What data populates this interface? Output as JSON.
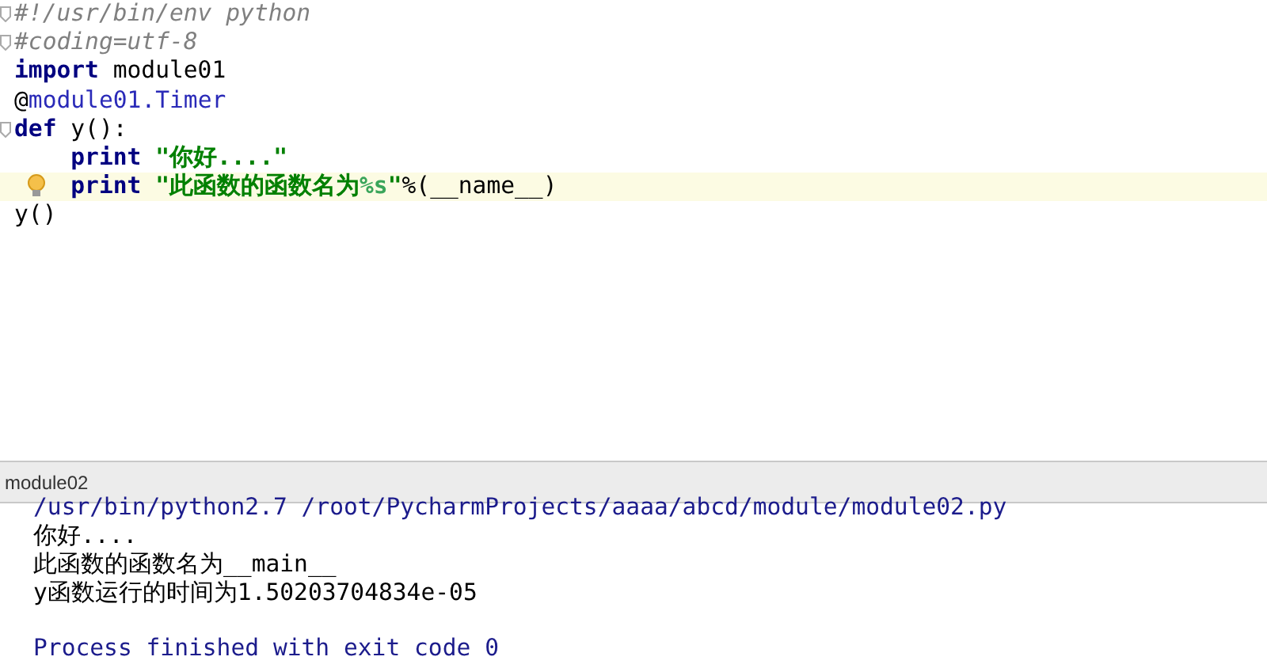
{
  "editor": {
    "lines": [
      {
        "current": false,
        "bulb": false,
        "foldable": true,
        "tokens": [
          {
            "kind": "comment",
            "text": "#!/usr/bin/env python"
          }
        ]
      },
      {
        "current": false,
        "bulb": false,
        "foldable": true,
        "tokens": [
          {
            "kind": "comment",
            "text": "#coding=utf-8"
          }
        ]
      },
      {
        "current": false,
        "bulb": false,
        "foldable": false,
        "tokens": [
          {
            "kind": "keyword",
            "text": "import "
          },
          {
            "kind": "plain",
            "text": "module01"
          }
        ]
      },
      {
        "current": false,
        "bulb": false,
        "foldable": false,
        "tokens": [
          {
            "kind": "plain",
            "text": "@"
          },
          {
            "kind": "decorator",
            "text": "module01.Timer"
          }
        ]
      },
      {
        "current": false,
        "bulb": false,
        "foldable": true,
        "tokens": [
          {
            "kind": "keyword",
            "text": "def "
          },
          {
            "kind": "plain",
            "text": "y():"
          }
        ],
        "children": [
          {
            "current": false,
            "bulb": false,
            "foldable": false,
            "tokens": [
              {
                "kind": "keyword",
                "text": "print "
              },
              {
                "kind": "string",
                "text": "\"你好....\""
              }
            ]
          },
          {
            "current": true,
            "bulb": true,
            "foldable": false,
            "tokens": [
              {
                "kind": "keyword",
                "text": "print "
              },
              {
                "kind": "string",
                "text": "\"此函数的函数名为"
              },
              {
                "kind": "format",
                "text": "%s"
              },
              {
                "kind": "string",
                "text": "\""
              },
              {
                "kind": "plain",
                "text": "%(__name__)"
              }
            ]
          }
        ]
      },
      {
        "current": false,
        "bulb": false,
        "foldable": false,
        "tokens": [
          {
            "kind": "plain",
            "text": "y()"
          }
        ]
      }
    ]
  },
  "run_panel": {
    "title": "module02",
    "output": [
      {
        "kind": "command",
        "text": "/usr/bin/python2.7 /root/PycharmProjects/aaaa/abcd/module/module02.py"
      },
      {
        "kind": "stdout",
        "text": "你好...."
      },
      {
        "kind": "stdout",
        "text": "此函数的函数名为__main__"
      },
      {
        "kind": "stdout",
        "text": "y函数运行的时间为1.50203704834e-05"
      },
      {
        "kind": "system",
        "text": "Process finished with exit code 0"
      }
    ]
  }
}
